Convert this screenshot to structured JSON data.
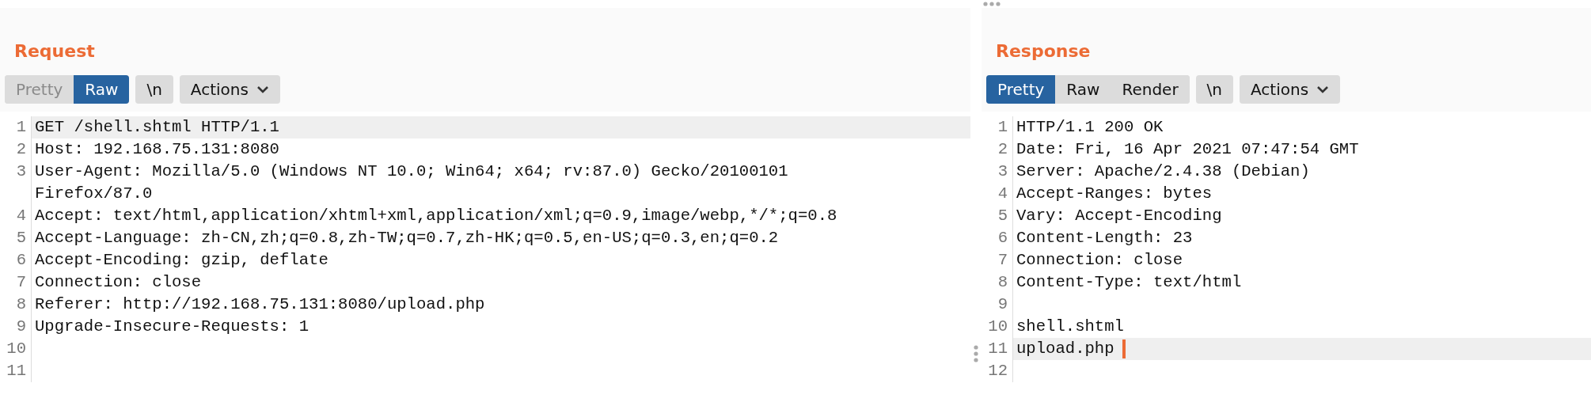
{
  "panes": [
    {
      "title": "Request",
      "views": [
        {
          "label": "Pretty",
          "selected": false,
          "disabled": true
        },
        {
          "label": "Raw",
          "selected": true,
          "disabled": false
        }
      ],
      "newline_button": "\\n",
      "actions_button": "Actions",
      "lines": [
        {
          "number": "1",
          "text": "GET /shell.shtml HTTP/1.1",
          "current": true
        },
        {
          "number": "2",
          "text": "Host: 192.168.75.131:8080",
          "current": false
        },
        {
          "number": "3",
          "text": "User-Agent: Mozilla/5.0 (Windows NT 10.0; Win64; x64; rv:87.0) Gecko/20100101 Firefox/87.0",
          "current": false
        },
        {
          "number": "4",
          "text": "Accept: text/html,application/xhtml+xml,application/xml;q=0.9,image/webp,*/*;q=0.8",
          "current": false
        },
        {
          "number": "5",
          "text": "Accept-Language: zh-CN,zh;q=0.8,zh-TW;q=0.7,zh-HK;q=0.5,en-US;q=0.3,en;q=0.2",
          "current": false
        },
        {
          "number": "6",
          "text": "Accept-Encoding: gzip, deflate",
          "current": false
        },
        {
          "number": "7",
          "text": "Connection: close",
          "current": false
        },
        {
          "number": "8",
          "text": "Referer: http://192.168.75.131:8080/upload.php",
          "current": false
        },
        {
          "number": "9",
          "text": "Upgrade-Insecure-Requests: 1",
          "current": false
        },
        {
          "number": "10",
          "current": false
        },
        {
          "number": "11",
          "current": false
        }
      ]
    },
    {
      "title": "Response",
      "views": [
        {
          "label": "Pretty",
          "selected": true,
          "disabled": false
        },
        {
          "label": "Raw",
          "selected": false,
          "disabled": false
        },
        {
          "label": "Render",
          "selected": false,
          "disabled": false
        }
      ],
      "newline_button": "\\n",
      "actions_button": "Actions",
      "lines": [
        {
          "number": "1",
          "text": "HTTP/1.1 200 OK",
          "current": false
        },
        {
          "number": "2",
          "text": "Date: Fri, 16 Apr 2021 07:47:54 GMT",
          "current": false
        },
        {
          "number": "3",
          "text": "Server: Apache/2.4.38 (Debian)",
          "current": false
        },
        {
          "number": "4",
          "text": "Accept-Ranges: bytes",
          "current": false
        },
        {
          "number": "5",
          "text": "Vary: Accept-Encoding",
          "current": false
        },
        {
          "number": "6",
          "text": "Content-Length: 23",
          "current": false
        },
        {
          "number": "7",
          "text": "Connection: close",
          "current": false
        },
        {
          "number": "8",
          "text": "Content-Type: text/html",
          "current": false
        },
        {
          "number": "9",
          "current": false
        },
        {
          "number": "10",
          "text": "shell.shtml",
          "current": false
        },
        {
          "number": "11",
          "text": "upload.php",
          "current": true
        },
        {
          "number": "12",
          "current": false
        }
      ]
    }
  ]
}
